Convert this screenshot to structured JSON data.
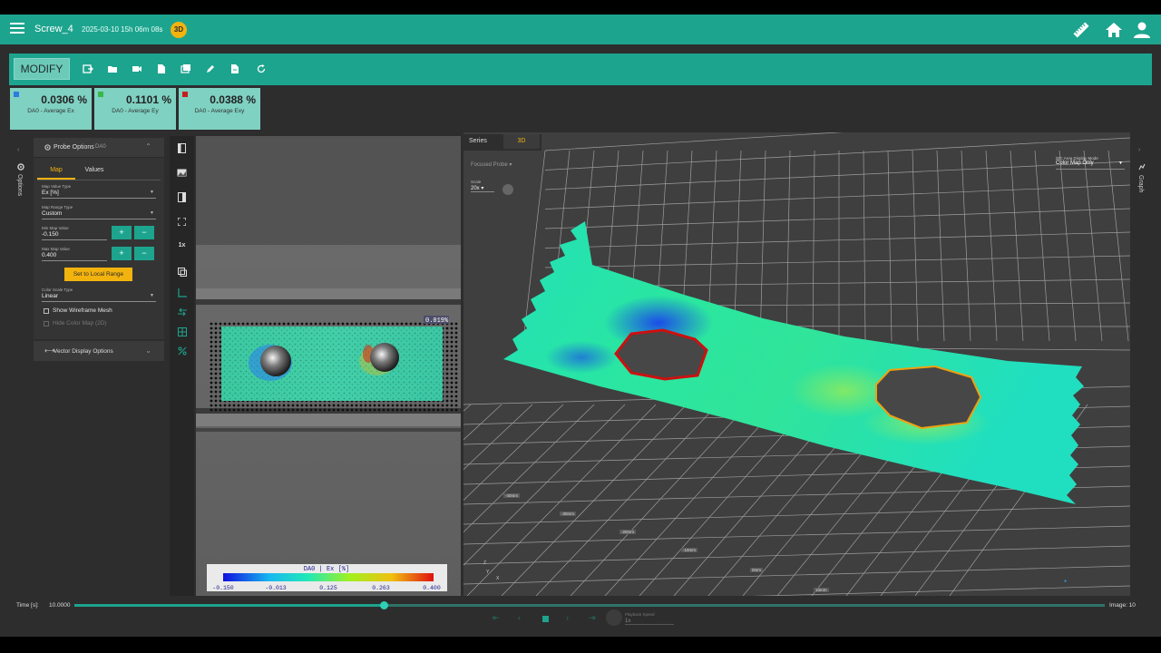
{
  "app": {
    "title": "Screw_4",
    "timestamp": "2025-03-10 15h 06m 08s",
    "mode_badge": "3D",
    "accent_color": "#1da48e"
  },
  "toolbar": {
    "modify_label": "MODIFY",
    "icons": [
      "export-icon",
      "folder-icon",
      "camera-icon",
      "document-icon",
      "gallery-icon",
      "edit-icon",
      "report-icon",
      "refresh-icon"
    ]
  },
  "stats": [
    {
      "value": "0.0306 %",
      "label": "DA0 -  Average Ex",
      "color": "#2b7be0"
    },
    {
      "value": "0.1101 %",
      "label": "DA0 -  Average Ey",
      "color": "#38b84a"
    },
    {
      "value": "0.0388 %",
      "label": "DA0 -  Average Exy",
      "color": "#c41f1f"
    }
  ],
  "side_tabs": {
    "left": "Options",
    "right": "Graph"
  },
  "probe": {
    "title": "Probe Options",
    "source": "DA0",
    "tabs": [
      "Map",
      "Values"
    ],
    "active_tab": "Map",
    "map_value_type": {
      "label": "Map Value Type",
      "value": "Ex [%]"
    },
    "map_range_type": {
      "label": "Map Range Type",
      "value": "Custom"
    },
    "min_map_value": {
      "label": "Min Map Value",
      "value": "-0.150"
    },
    "max_map_value": {
      "label": "Max Map Value",
      "value": "0.400"
    },
    "plus": "+",
    "minus": "−",
    "local_range_label": "Set to Local Range",
    "color_scale_type": {
      "label": "Color Scale Type",
      "value": "Linear"
    },
    "show_wireframe": "Show Wireframe Mesh",
    "hide_colormap": "Hide Color Map (2D)"
  },
  "vector_panel": {
    "title": "Vector Display Options"
  },
  "viewer": {
    "zoom_label": "1x",
    "probe_readout": "0.019%",
    "legend": {
      "title": "DA0 |  Ex [%]",
      "ticks": [
        "-0.150",
        "-0.013",
        "0.125",
        "0.263",
        "0.400"
      ]
    }
  },
  "view3d": {
    "tabs": [
      "Series",
      "3D"
    ],
    "active_tab": "3D",
    "focused_probe": "Focused Probe",
    "scale_label": "Scale",
    "scale_value": "20x",
    "display_mode_label": "DIC Area Display Mode",
    "display_mode_value": "Color Map Only",
    "axis_ticks": [
      "-40mm",
      "-30mm",
      "-20mm",
      "-10mm",
      "0mm",
      "10mm"
    ],
    "axis_letters": [
      "Z",
      "Y",
      "X"
    ]
  },
  "timeline": {
    "time_label": "Time [s]:",
    "time_value": "10.0000",
    "progress": 0.3,
    "image_label": "Image: 10",
    "playback_label": "Playback Speed",
    "playback_value": "1x"
  }
}
